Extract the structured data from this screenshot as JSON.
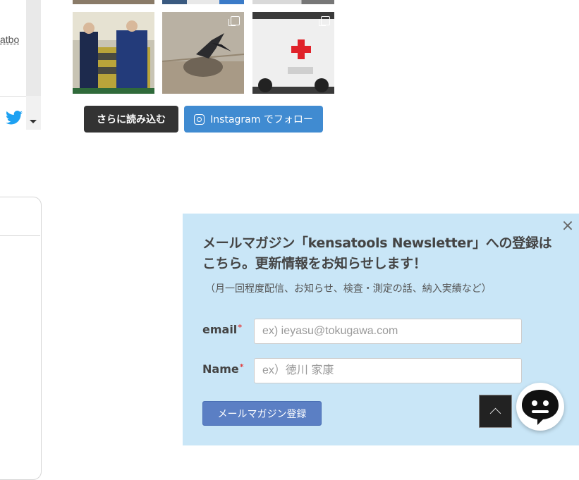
{
  "twitter_widget": {
    "partial_text": "atbo",
    "icon": "twitter-bird-icon",
    "menu_icon": "caret-down-icon",
    "brand_color": "#1da1f2"
  },
  "instagram": {
    "load_more_label": "さらに読み込む",
    "follow_label": "Instagram でフォロー",
    "follow_color": "#408bd1"
  },
  "newsletter": {
    "title": "メールマガジン「kensatools Newsletter」への登録はこちら。更新情報をお知らせします！",
    "subtitle": "（月一回程度配信、お知らせ、検査・測定の話、納入実績など）",
    "email_label": "email",
    "email_placeholder": "ex) ieyasu@tokugawa.com",
    "name_label": "Name",
    "name_placeholder": "ex）徳川 家康",
    "required_mark": "*",
    "submit_label": "メールマガジン登録",
    "close_symbol": "×",
    "background_color": "#c9e6f7"
  },
  "widgets": {
    "back_to_top_icon": "chevron-up-icon",
    "chat_icon": "chat-face-icon"
  }
}
